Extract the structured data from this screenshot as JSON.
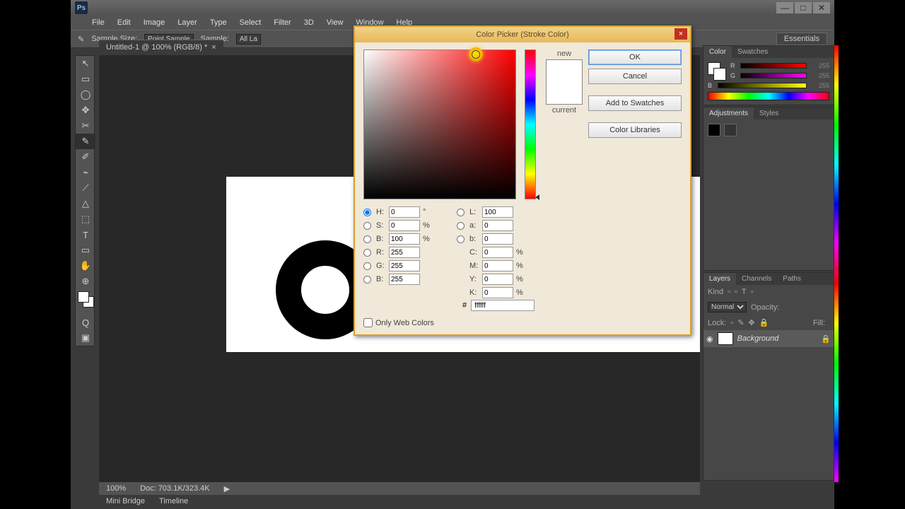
{
  "app": {
    "logo": "Ps"
  },
  "window": {
    "min": "—",
    "max": "□",
    "close": "✕"
  },
  "menu": [
    "File",
    "Edit",
    "Image",
    "Layer",
    "Type",
    "Select",
    "Filter",
    "3D",
    "View",
    "Window",
    "Help"
  ],
  "options": {
    "sample_size_label": "Sample Size:",
    "sample_size_value": "Point Sample",
    "sample_label": "Sample:",
    "sample_value": "All La",
    "workspace": "Essentials"
  },
  "doc_tab": {
    "label": "Untitled-1 @ 100% (RGB/8) *",
    "close": "×"
  },
  "tools": [
    "↖",
    "▭",
    "◯",
    "✥",
    "✂",
    "✎",
    "✐",
    "⌁",
    "⟋",
    "△",
    "⬚",
    "T",
    "▭",
    "✋",
    "⊕",
    "Q"
  ],
  "status": {
    "zoom": "100%",
    "doc": "Doc: 703.1K/323.4K"
  },
  "bottom": {
    "minibridge": "Mini Bridge",
    "timeline": "Timeline"
  },
  "panels": {
    "color": {
      "tab1": "Color",
      "tab2": "Swatches",
      "r": {
        "l": "R",
        "v": "255"
      },
      "g": {
        "l": "G",
        "v": "255"
      },
      "b": {
        "l": "B",
        "v": "255"
      }
    },
    "adjust": {
      "tab1": "Adjustments",
      "tab2": "Styles"
    },
    "layers": {
      "tab1": "Layers",
      "tab2": "Channels",
      "tab3": "Paths",
      "kind": "Kind",
      "mode": "Normal",
      "opacity_l": "Opacity:",
      "opacity_v": "",
      "lock_l": "Lock:",
      "fill_l": "Fill:",
      "fill_v": "",
      "layer_name": "Background"
    }
  },
  "picker": {
    "title": "Color Picker (Stroke Color)",
    "close": "×",
    "new_l": "new",
    "current_l": "current",
    "ok": "OK",
    "cancel": "Cancel",
    "add": "Add to Swatches",
    "libraries": "Color Libraries",
    "web_only": "Only Web Colors",
    "H": {
      "l": "H:",
      "v": "0",
      "u": "°"
    },
    "S": {
      "l": "S:",
      "v": "0",
      "u": "%"
    },
    "Br": {
      "l": "B:",
      "v": "100",
      "u": "%"
    },
    "L": {
      "l": "L:",
      "v": "100"
    },
    "a": {
      "l": "a:",
      "v": "0"
    },
    "b": {
      "l": "b:",
      "v": "0"
    },
    "R": {
      "l": "R:",
      "v": "255"
    },
    "G": {
      "l": "G:",
      "v": "255"
    },
    "Bl": {
      "l": "B:",
      "v": "255"
    },
    "C": {
      "l": "C:",
      "v": "0",
      "u": "%"
    },
    "M": {
      "l": "M:",
      "v": "0",
      "u": "%"
    },
    "Y": {
      "l": "Y:",
      "v": "0",
      "u": "%"
    },
    "K": {
      "l": "K:",
      "v": "0",
      "u": "%"
    },
    "hex_l": "#",
    "hex_v": "ffffff"
  }
}
